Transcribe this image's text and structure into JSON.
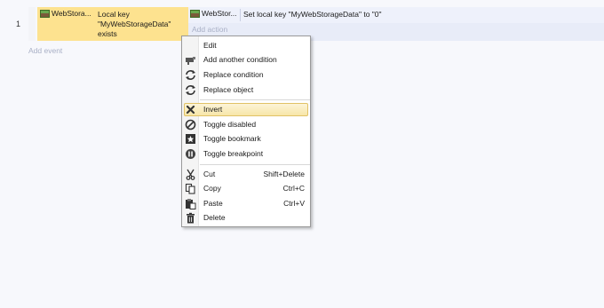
{
  "sheet": {
    "row_number": "1",
    "add_event": "Add event"
  },
  "event": {
    "condition_object": "WebStora...",
    "condition_lines": [
      "Local key",
      "\"MyWebStorageData\"",
      "exists"
    ],
    "action_object": "WebStor...",
    "action_text": "Set local key \"MyWebStorageData\" to \"0\"",
    "add_action": "Add action"
  },
  "context_menu": {
    "items": [
      {
        "label": "Edit",
        "shortcut": "",
        "icon": "none"
      },
      {
        "label": "Add another condition",
        "shortcut": "",
        "icon": "add-condition-icon"
      },
      {
        "label": "Replace condition",
        "shortcut": "",
        "icon": "replace-icon"
      },
      {
        "label": "Replace object",
        "shortcut": "",
        "icon": "replace-icon"
      },
      {
        "label": "Invert",
        "shortcut": "",
        "icon": "invert-x-icon",
        "highlighted": true
      },
      {
        "label": "Toggle disabled",
        "shortcut": "",
        "icon": "disabled-icon"
      },
      {
        "label": "Toggle bookmark",
        "shortcut": "",
        "icon": "bookmark-icon"
      },
      {
        "label": "Toggle breakpoint",
        "shortcut": "",
        "icon": "breakpoint-icon"
      },
      {
        "label": "Cut",
        "shortcut": "Shift+Delete",
        "icon": "cut-icon"
      },
      {
        "label": "Copy",
        "shortcut": "Ctrl+C",
        "icon": "copy-icon"
      },
      {
        "label": "Paste",
        "shortcut": "Ctrl+V",
        "icon": "paste-icon"
      },
      {
        "label": "Delete",
        "shortcut": "",
        "icon": "delete-icon"
      }
    ]
  },
  "colors": {
    "condition_bg": "#fde28f",
    "action_bg": "#e8ecf8",
    "highlight_bg": "#f7e6a8",
    "page_bg": "#f7f8fc"
  }
}
